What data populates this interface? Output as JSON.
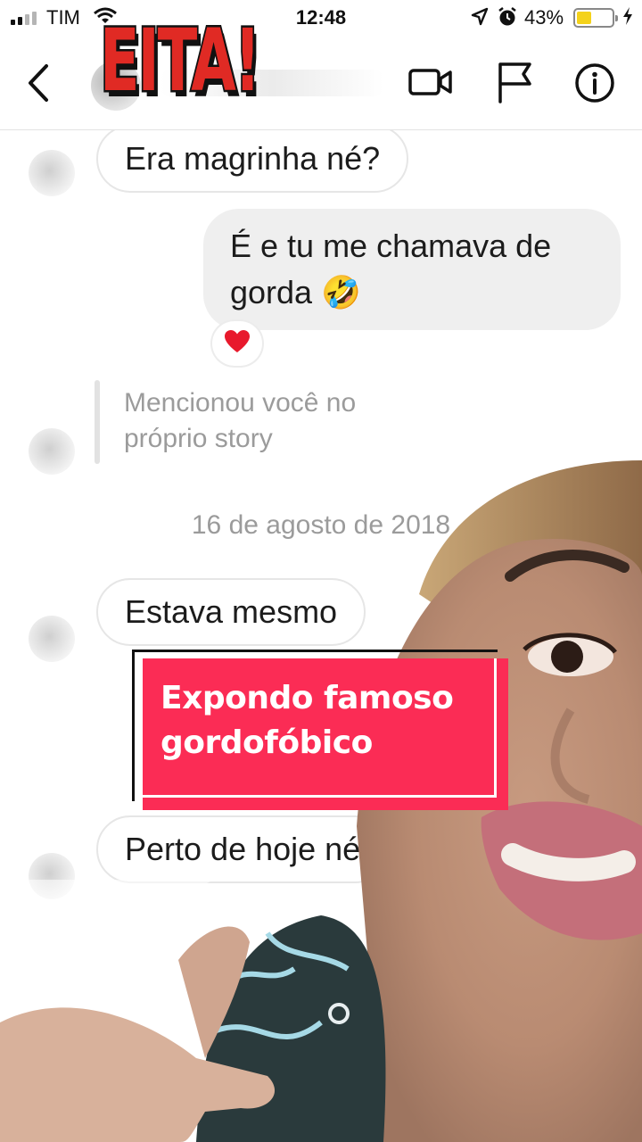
{
  "status_bar": {
    "carrier": "TIM",
    "time": "12:48",
    "battery_percent": "43%",
    "battery_level": 0.43,
    "icons": [
      "signal-icon",
      "wifi-icon",
      "location-icon",
      "alarm-icon",
      "battery-icon",
      "charging-icon"
    ]
  },
  "header": {
    "sticker": "EITA!",
    "icons": [
      "back-chevron-icon",
      "video-call-icon",
      "flag-icon",
      "info-icon"
    ]
  },
  "messages": [
    {
      "side": "in",
      "text": "Era magrinha né?"
    },
    {
      "side": "out",
      "line1": "É e tu me chamava de",
      "line2": "gorda 🤣",
      "reaction": "❤️"
    },
    {
      "side": "mention",
      "line1": "Mencionou você no",
      "line2": "próprio story"
    },
    {
      "side": "date",
      "text": "16 de agosto de 2018"
    },
    {
      "side": "in",
      "text": "Estava mesmo"
    },
    {
      "side": "in",
      "text": "Perto de hoje né"
    }
  ],
  "caption": {
    "line1": "Expondo famoso",
    "line2": "gordofóbico"
  },
  "colors": {
    "caption_bg": "#fb2c55",
    "sticker_red": "#e02a24",
    "outgoing_bubble": "#efefef",
    "battery_fill": "#f4d21a"
  }
}
